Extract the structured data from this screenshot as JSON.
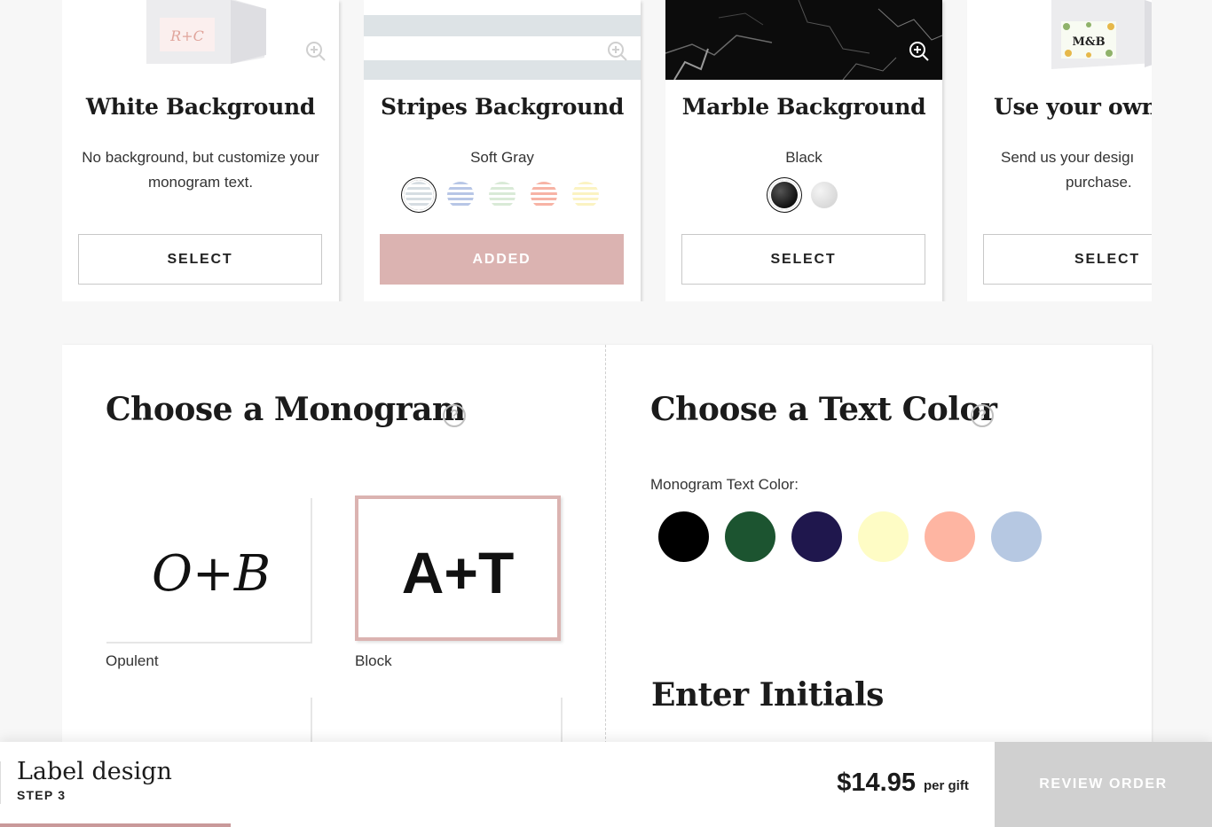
{
  "backgrounds": [
    {
      "title": "White Background",
      "description": "No background, but customize your monogram text.",
      "button": "SELECT",
      "thumb_text": "R+C"
    },
    {
      "title": "Stripes Background",
      "variant": "Soft Gray",
      "button": "ADDED",
      "swatches": [
        "#d6dde2",
        "#b7c6e6",
        "#d9ead7",
        "#f7b3a5",
        "#fbf3c2"
      ],
      "selected_swatch": 0
    },
    {
      "title": "Marble Background",
      "variant": "Black",
      "button": "SELECT",
      "swatches": [
        "#111111",
        "#d9d9d9"
      ],
      "selected_swatch": 0
    },
    {
      "title": "Use your own c",
      "description": "Send us your desig purchase.",
      "description_line1": "Send us your desigı",
      "description_line2": "purchase.",
      "button": "SELECT",
      "thumb_text": "M&B"
    }
  ],
  "monogram": {
    "heading": "Choose a Monogram",
    "help": "?",
    "options": [
      {
        "label": "Opulent",
        "sample": "O+B",
        "selected": false
      },
      {
        "label": "Block",
        "sample": "A+T",
        "selected": true
      }
    ]
  },
  "text_color": {
    "heading": "Choose a Text Color",
    "help": "?",
    "label": "Monogram Text Color:",
    "colors": [
      "#000000",
      "#1c5430",
      "#1f174d",
      "#fefcc5",
      "#feb5a2",
      "#b6c8e2"
    ]
  },
  "initials": {
    "heading": "Enter Initials"
  },
  "footer": {
    "step_title": "Label design",
    "step_number": "STEP 3",
    "price": "$14.95",
    "price_suffix": "per gift",
    "review_button": "REVIEW ORDER",
    "progress_fraction": 0.19
  },
  "colors": {
    "accent": "#dbb3b1",
    "disabled": "#d0d0d0"
  }
}
